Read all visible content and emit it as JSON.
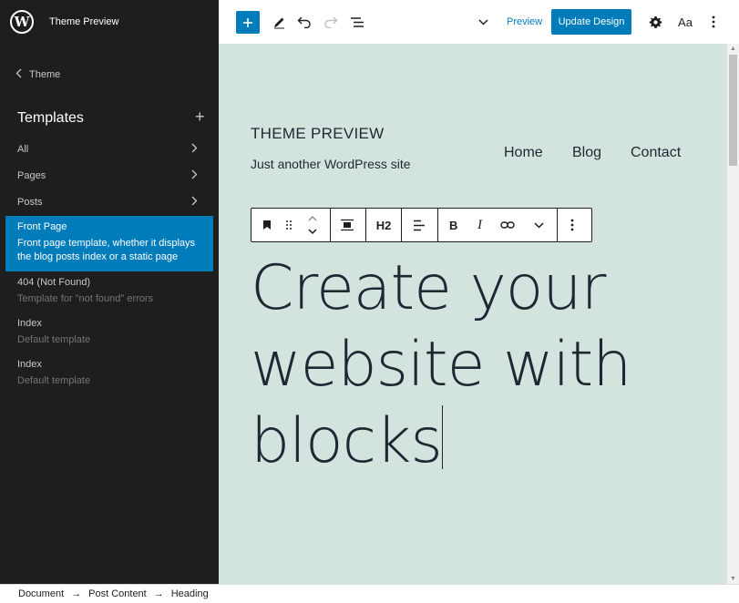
{
  "site_hub": {
    "title": "Theme Preview"
  },
  "sidebar": {
    "back_label": "Theme",
    "section_title": "Templates",
    "add_icon": "plus-icon",
    "nav": [
      {
        "label": "All"
      },
      {
        "label": "Pages"
      },
      {
        "label": "Posts"
      }
    ],
    "templates": [
      {
        "title": "Front Page",
        "description": "Front page template, whether it displays the blog posts index or a static page",
        "active": true
      },
      {
        "title": "404 (Not Found)",
        "description": "Template for \"not found\" errors",
        "active": false
      },
      {
        "title": "Index",
        "description": "Default template",
        "active": false
      },
      {
        "title": "Index",
        "description": "Default template",
        "active": false
      }
    ]
  },
  "toolbar": {
    "preview_label": "Preview",
    "update_label": "Update Design",
    "styles_label": "Aa"
  },
  "canvas": {
    "site_name": "THEME PREVIEW",
    "tagline": "Just another WordPress site",
    "nav": [
      "Home",
      "Blog",
      "Contact"
    ],
    "block_toolbar": {
      "heading_level": "H2"
    },
    "heading_lines": [
      "Create your",
      "website with",
      "blocks"
    ]
  },
  "breadcrumb": [
    "Document",
    "Post Content",
    "Heading"
  ],
  "colors": {
    "sidebar_bg": "#1e1e1e",
    "accent": "#007cba",
    "canvas_bg": "#d2e4dd",
    "text_dark": "#1e2833"
  }
}
